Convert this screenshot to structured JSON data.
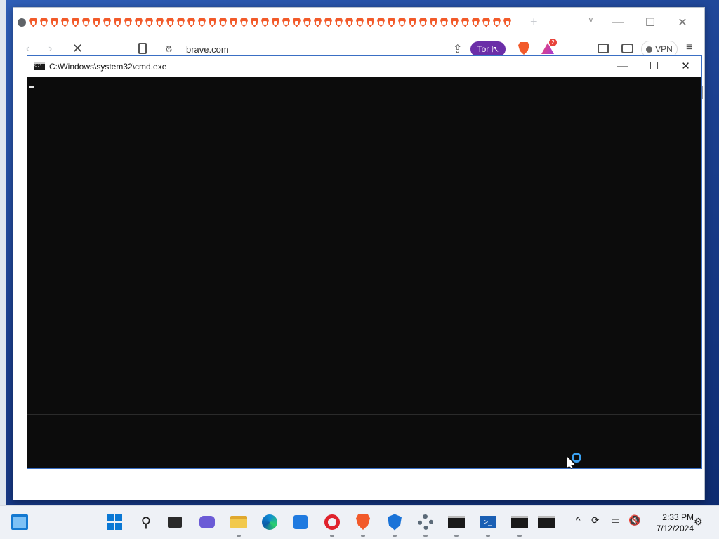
{
  "browser": {
    "tab_count": 46,
    "window_controls": {
      "new_tab": "+",
      "tab_search": "∨",
      "minimize": "—",
      "maximize": "☐",
      "close": "✕"
    },
    "toolbar": {
      "back": "‹",
      "forward": "›",
      "stop": "✕",
      "site_info": "⚙",
      "url": "brave.com",
      "share": "⇪",
      "tor_label": "Tor",
      "tor_icon": "⇱",
      "rewards_badge": "2",
      "vpn_label": "VPN",
      "menu": "≡"
    }
  },
  "cmd": {
    "title": "C:\\Windows\\system32\\cmd.exe",
    "controls": {
      "minimize": "—",
      "maximize": "☐",
      "close": "✕"
    }
  },
  "taskbar": {
    "tray": {
      "chevron": "^",
      "sync": "⟳",
      "network": "▭",
      "volume": "🔇"
    },
    "time": "2:33 PM",
    "date": "7/12/2024",
    "notifications": "⚙"
  },
  "colors": {
    "cmd_background": "#0c0c0c",
    "tor_button": "#6b2ea8",
    "brave_orange": "#f25a2a",
    "taskbar": "#eef1f6"
  }
}
